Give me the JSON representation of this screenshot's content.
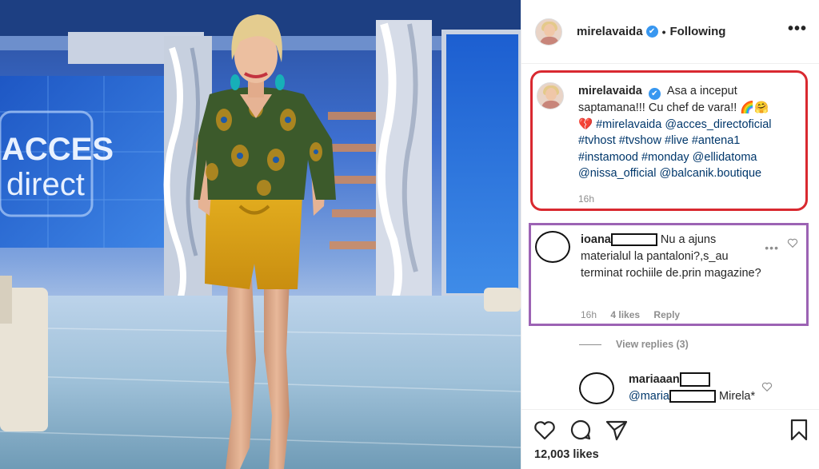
{
  "post": {
    "username": "mirelavaida",
    "verified_badge": "✔",
    "separator": "•",
    "follow_status": "Following",
    "more_icon": "•••",
    "caption": {
      "username": "mirelavaida",
      "text_line1": "Asa a inceput",
      "text_line2": "saptamana!!! Cu chef de vara!!",
      "emoji1": "🌈",
      "emoji2": "🤗",
      "emoji3": "💔",
      "hashtag_line3": "#mirelavaida @acces_directoficial",
      "hashtag_line4": "#tvhost #tvshow #live #antena1",
      "hashtag_line5": "#instamood #monday @ellidatoma",
      "hashtag_line6": "@nissa_official @balcanik.boutique",
      "time": "16h"
    },
    "comment1": {
      "username": "ioana",
      "text": "Nu a ajuns materialul la pantaloni?,s_au terminat rochiile de.prin magazine?",
      "time": "16h",
      "likes": "4 likes",
      "reply": "Reply",
      "more": "•••"
    },
    "view_replies": "View replies (3)",
    "comment2": {
      "username": "mariaaan",
      "mention": "@maria",
      "text": "Mirela*"
    },
    "likes_count": "12,003 likes",
    "icons": {
      "like": "heart-icon",
      "comment": "comment-icon",
      "share": "share-icon",
      "save": "bookmark-icon"
    }
  },
  "photo": {
    "logo_line1": "ACCES",
    "logo_line2": "direct"
  },
  "colors": {
    "caption_frame": "#d92930",
    "comment_frame": "#9c63b4",
    "link": "#00376b",
    "verified": "#3897f0",
    "muted": "#8e8e8e"
  }
}
